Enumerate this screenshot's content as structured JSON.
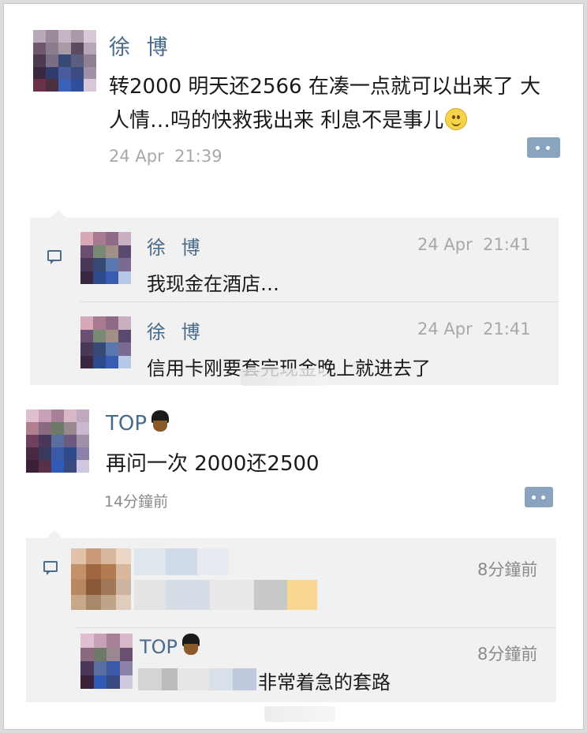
{
  "post1": {
    "author": "徐 博",
    "text": "转2000 明天还2566 在凑一点就可以出来了 大人情…吗的快救我出来 利息不是事儿",
    "line1": "转2000 明天还2566 在凑一点就可以出来了 大",
    "line2": "人情…吗的快救我出来 利息不是事儿",
    "emoji": "smiley-emoji",
    "time": "24 Apr  21:39",
    "replies": [
      {
        "author": "徐 博",
        "time": "24 Apr  21:41",
        "text": "我现金在酒店…"
      },
      {
        "author": "徐 博",
        "time": "24 Apr  21:41",
        "text": "信用卡刚要套完现金晚上就进去了"
      }
    ]
  },
  "post2": {
    "author": "TOP",
    "emoji": "guard-emoji",
    "text": "再问一次 2000还2500",
    "time": "14分鐘前",
    "replies": [
      {
        "author": "",
        "time": "8分鐘前",
        "text": ""
      },
      {
        "author": "TOP",
        "time": "8分鐘前",
        "text": "非常着急的套路"
      }
    ]
  },
  "colors": {
    "name": "#4a6b8a",
    "bubble": "#8aa4bf",
    "reply_bg": "#f1f1f1",
    "time": "#a8a8a8"
  }
}
